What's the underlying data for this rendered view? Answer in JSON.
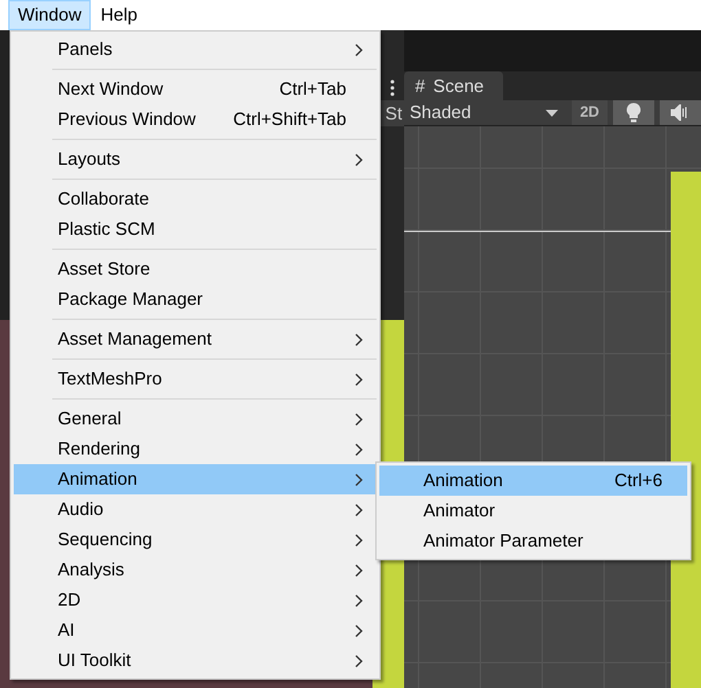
{
  "menubar": [
    {
      "label": "Window",
      "selected": true
    },
    {
      "label": "Help",
      "selected": false
    }
  ],
  "menu": [
    {
      "kind": "item",
      "label": "Panels",
      "has_submenu": true,
      "selected": false
    },
    {
      "kind": "separator"
    },
    {
      "kind": "item",
      "label": "Next Window",
      "shortcut": "Ctrl+Tab",
      "has_submenu": false,
      "selected": false
    },
    {
      "kind": "item",
      "label": "Previous Window",
      "shortcut": "Ctrl+Shift+Tab",
      "has_submenu": false,
      "selected": false
    },
    {
      "kind": "separator"
    },
    {
      "kind": "item",
      "label": "Layouts",
      "has_submenu": true,
      "selected": false
    },
    {
      "kind": "separator"
    },
    {
      "kind": "item",
      "label": "Collaborate",
      "has_submenu": false,
      "selected": false
    },
    {
      "kind": "item",
      "label": "Plastic SCM",
      "has_submenu": false,
      "selected": false
    },
    {
      "kind": "separator"
    },
    {
      "kind": "item",
      "label": "Asset Store",
      "has_submenu": false,
      "selected": false
    },
    {
      "kind": "item",
      "label": "Package Manager",
      "has_submenu": false,
      "selected": false
    },
    {
      "kind": "separator"
    },
    {
      "kind": "item",
      "label": "Asset Management",
      "has_submenu": true,
      "selected": false
    },
    {
      "kind": "separator"
    },
    {
      "kind": "item",
      "label": "TextMeshPro",
      "has_submenu": true,
      "selected": false
    },
    {
      "kind": "separator"
    },
    {
      "kind": "item",
      "label": "General",
      "has_submenu": true,
      "selected": false
    },
    {
      "kind": "item",
      "label": "Rendering",
      "has_submenu": true,
      "selected": false
    },
    {
      "kind": "item",
      "label": "Animation",
      "has_submenu": true,
      "selected": true
    },
    {
      "kind": "item",
      "label": "Audio",
      "has_submenu": true,
      "selected": false
    },
    {
      "kind": "item",
      "label": "Sequencing",
      "has_submenu": true,
      "selected": false
    },
    {
      "kind": "item",
      "label": "Analysis",
      "has_submenu": true,
      "selected": false
    },
    {
      "kind": "item",
      "label": "2D",
      "has_submenu": true,
      "selected": false
    },
    {
      "kind": "item",
      "label": "AI",
      "has_submenu": true,
      "selected": false
    },
    {
      "kind": "item",
      "label": "UI Toolkit",
      "has_submenu": true,
      "selected": false
    }
  ],
  "submenu": [
    {
      "label": "Animation",
      "shortcut": "Ctrl+6",
      "selected": true
    },
    {
      "label": "Animator",
      "selected": false
    },
    {
      "label": "Animator Parameter",
      "selected": false
    }
  ],
  "editor": {
    "tab_fragment": "St",
    "scene_tab": {
      "icon": "#",
      "label": "Scene"
    },
    "shading_mode": "Shaded",
    "toggle_2d": "2D",
    "toggle_2d_on": false,
    "lighting_on": true,
    "audio_on": true
  }
}
